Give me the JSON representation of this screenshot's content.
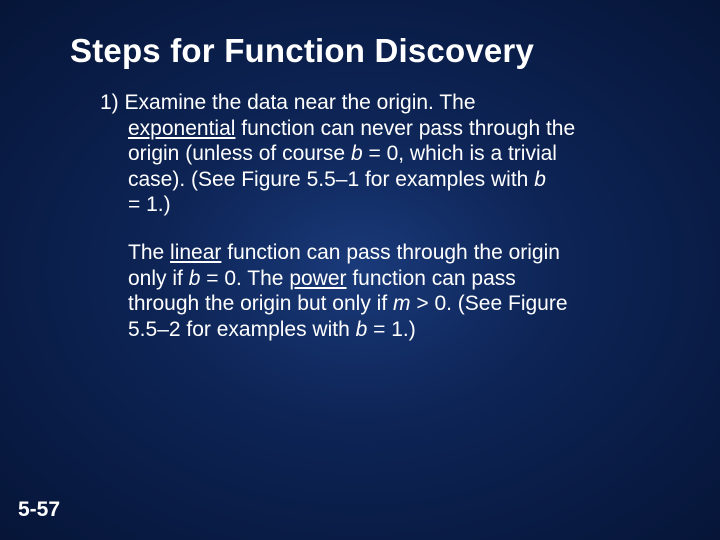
{
  "title": "Steps for Function Discovery",
  "step": {
    "num": "1) ",
    "line1a": "Examine the data near the origin. The",
    "line2a_underline": "exponential",
    "line2b": " function can never pass through the",
    "line3a": "origin (unless of course ",
    "line3b_ital": "b ",
    "line3c_sym": "=",
    "line3d": " 0, which is a trivial",
    "line4a": "case). (See Figure 5.5–1 for examples with ",
    "line4b_ital": "b",
    "line5a_sym": "=",
    "line5b": " 1.)"
  },
  "para2": {
    "line1a": "The ",
    "line1b_underline": "linear",
    "line1c": " function can pass through the origin",
    "line2a": "only if ",
    "line2b_ital": "b ",
    "line2c_sym": "=",
    "line2d": " 0. The ",
    "line2e_underline": "power",
    "line2f": " function can pass",
    "line3a": "through the origin but only if ",
    "line3b_ital": "m ",
    "line3c_sym": ">",
    "line3d": " 0. (See Figure",
    "line4a": "5.5–2 for examples with ",
    "line4b_ital": "b ",
    "line4c_sym": "=",
    "line4d": " 1.)"
  },
  "pagenum": "5-57"
}
